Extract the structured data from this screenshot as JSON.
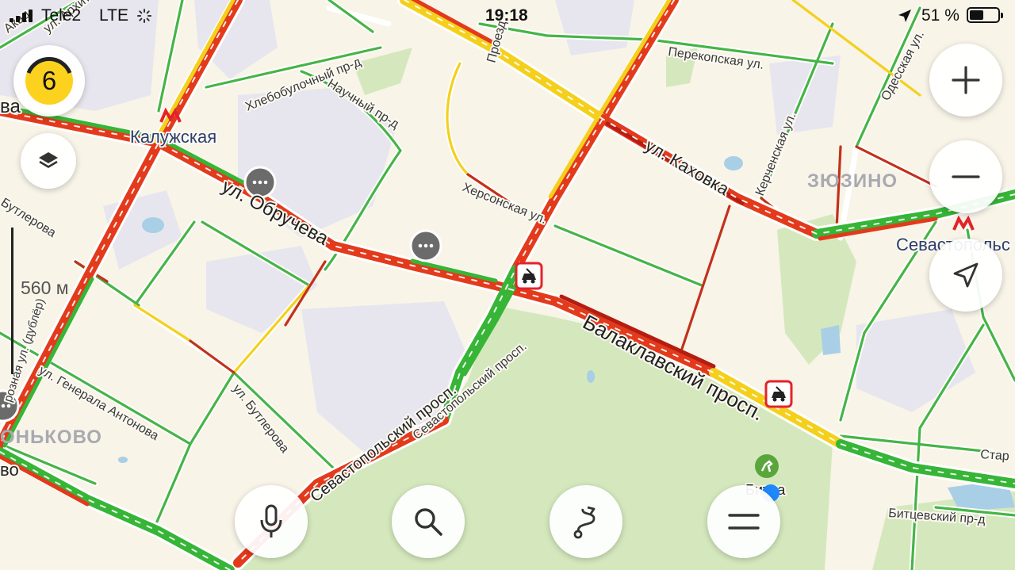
{
  "status_bar": {
    "carrier": "Tele2",
    "network": "LTE",
    "time": "19:18",
    "battery_percent": "51 %",
    "battery_level": 0.51,
    "icons": [
      "signal-bars-icon",
      "loading-spinner-icon",
      "location-arrow-icon",
      "battery-icon"
    ]
  },
  "traffic_score": {
    "value": "6",
    "color": "#fcd21f"
  },
  "scale": {
    "label": "560 м"
  },
  "controls": {
    "zoom_in": "plus-icon",
    "zoom_out": "minus-icon",
    "layers": "layers-icon",
    "my_location": "navigation-arrow-icon",
    "voice": "microphone-icon",
    "search": "search-icon",
    "routes": "route-icon",
    "menu": "menu-icon"
  },
  "colors": {
    "traffic_free": "#36b536",
    "traffic_slow": "#f4d01c",
    "traffic_jam": "#e33a1c",
    "traffic_standstill": "#b51d12",
    "park": "#d5e8bd",
    "background": "#f8f4e8",
    "user_location": "#1e88ff"
  },
  "map": {
    "streets": {
      "akademika": "Акад",
      "arhitektora": "ул. Архитек",
      "hlebobulochny": "Хлебобулочный пр-д",
      "nauchny": "Научный пр-д",
      "obrucheva": "ул. Обручева",
      "butlerova": "ул. Бутлерова",
      "butlerova_left": "Бутлерова",
      "generala_antonova": "ул. Генерала Антонова",
      "khersonskaya": "Херсонская ул.",
      "perekopskaya": "Перекопская ул.",
      "kakhovka": "ул. Каховка",
      "kerchenskaya": "Керченская ул.",
      "odesskaya": "Одесская ул.",
      "sevastopolsky": "Севастопольский просп.",
      "sevastopolsky_lower": "Севастопольский просп.",
      "balaklavsky": "Балаклавский просп.",
      "bitsevsky": "Битцевский пр-д",
      "proezd": "Проезд",
      "star": "Стар",
      "vozdushnaya": "розная ул. (дублёр)",
      "va": "ва",
      "vo": "во"
    },
    "districts": {
      "zyuzino": "ЗЮЗИНО",
      "konkovo": "ОНЬКОВО"
    },
    "metro": {
      "kaluzhskaya": "Калужская",
      "sevastopolskaya": "Севастопольс"
    },
    "places": {
      "bitsa": "Битца"
    },
    "map_icons": [
      "comment-icon",
      "accident-icon",
      "horse-riding-icon",
      "metro-icon"
    ]
  }
}
